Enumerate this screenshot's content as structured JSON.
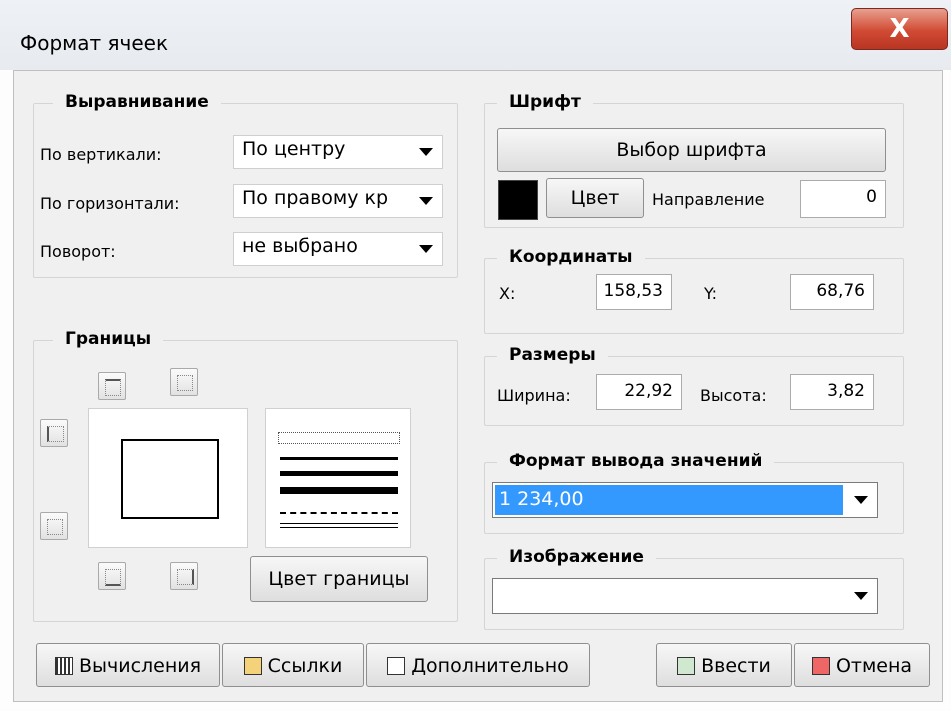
{
  "window": {
    "title": "Формат ячеек",
    "close_label": "X"
  },
  "alignment": {
    "group_label": "Выравнивание",
    "vertical_label": "По вертикали:",
    "vertical_value": "По центру",
    "horizontal_label": "По горизонтали:",
    "horizontal_value": "По правому кр",
    "rotation_label": "Поворот:",
    "rotation_value": "не выбрано"
  },
  "borders": {
    "group_label": "Границы",
    "border_color_button": "Цвет границы"
  },
  "font": {
    "group_label": "Шрифт",
    "choose_font_button": "Выбор шрифта",
    "color_button": "Цвет",
    "swatch_color": "#000000",
    "direction_label": "Направление",
    "direction_value": "0"
  },
  "coordinates": {
    "group_label": "Координаты",
    "x_label": "X:",
    "x_value": "158,53",
    "y_label": "Y:",
    "y_value": "68,76"
  },
  "size": {
    "group_label": "Размеры",
    "width_label": "Ширина:",
    "width_value": "22,92",
    "height_label": "Высота:",
    "height_value": "3,82"
  },
  "value_format": {
    "group_label": "Формат вывода значений",
    "selected_value": "1 234,00",
    "highlight_color": "#3399ff"
  },
  "image": {
    "group_label": "Изображение",
    "selected_value": ""
  },
  "footer": {
    "calc_button": "Вычисления",
    "links_button": "Ссылки",
    "advanced_button": "Дополнительно",
    "enter_button": "Ввести",
    "cancel_button": "Отмена"
  }
}
